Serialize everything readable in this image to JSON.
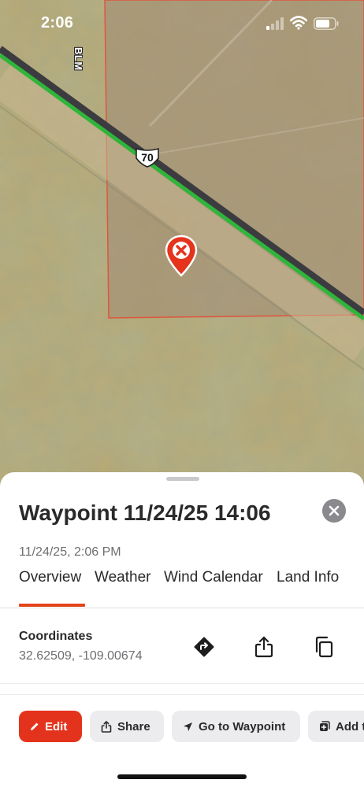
{
  "status_bar": {
    "time": "2:06"
  },
  "map": {
    "boundary_label": "BLM",
    "route_number": "70",
    "colors": {
      "terrain": "#b9a770",
      "parcel_fill": "#a08a73",
      "parcel_border": "#e0553d",
      "road": "#3c3c40",
      "route_line": "#2fb53a",
      "marker": "#e5331c"
    },
    "marker_icon": "close-x-pin-icon"
  },
  "sheet": {
    "title": "Waypoint 11/24/25 14:06",
    "date": "11/24/25, 2:06 PM",
    "tabs": [
      {
        "label": "Overview",
        "active": true
      },
      {
        "label": "Weather",
        "active": false
      },
      {
        "label": "Wind Calendar",
        "active": false
      },
      {
        "label": "Land Info",
        "active": false
      }
    ],
    "coordinates": {
      "label": "Coordinates",
      "value": "32.62509, -109.00674"
    },
    "actions": {
      "edit": "Edit",
      "share": "Share",
      "goto": "Go to Waypoint",
      "add": "Add t"
    },
    "accent_color": "#e4331c"
  }
}
